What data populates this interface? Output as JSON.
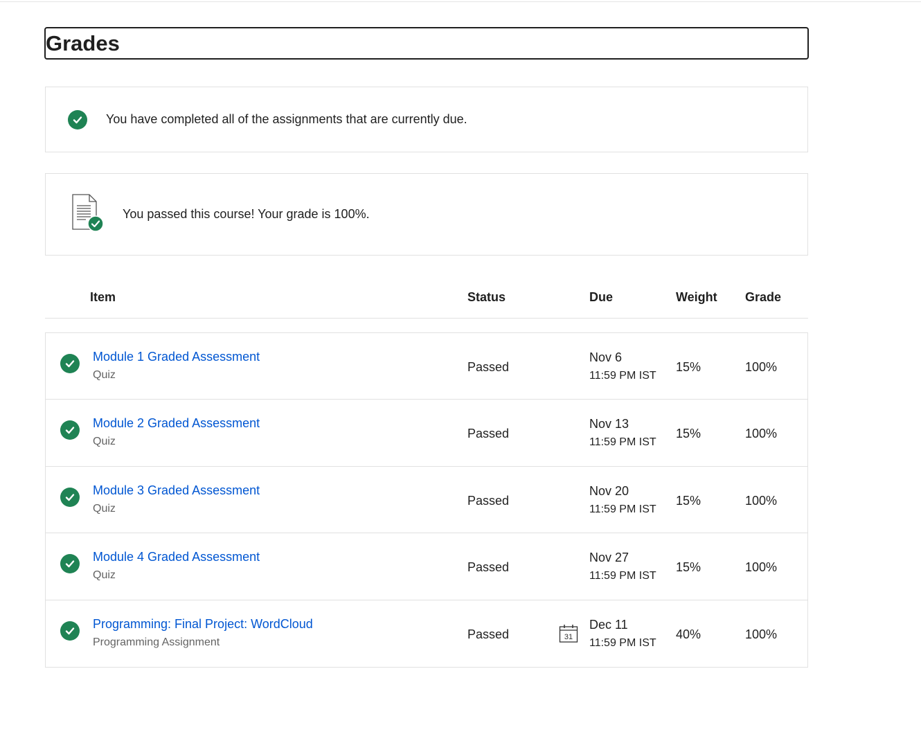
{
  "page": {
    "title": "Grades"
  },
  "banners": {
    "due_message": "You have completed all of the assignments that are currently due.",
    "pass_message": "You passed this course! Your grade is 100%."
  },
  "table": {
    "headers": {
      "item": "Item",
      "status": "Status",
      "due": "Due",
      "weight": "Weight",
      "grade": "Grade"
    },
    "rows": [
      {
        "title": "Module 1 Graded Assessment",
        "type": "Quiz",
        "status": "Passed",
        "due_date": "Nov 6",
        "due_time": "11:59 PM IST",
        "weight": "15%",
        "grade": "100%",
        "calendar": ""
      },
      {
        "title": "Module 2 Graded Assessment",
        "type": "Quiz",
        "status": "Passed",
        "due_date": "Nov 13",
        "due_time": "11:59 PM IST",
        "weight": "15%",
        "grade": "100%",
        "calendar": ""
      },
      {
        "title": "Module 3 Graded Assessment",
        "type": "Quiz",
        "status": "Passed",
        "due_date": "Nov 20",
        "due_time": "11:59 PM IST",
        "weight": "15%",
        "grade": "100%",
        "calendar": ""
      },
      {
        "title": "Module 4 Graded Assessment",
        "type": "Quiz",
        "status": "Passed",
        "due_date": "Nov 27",
        "due_time": "11:59 PM IST",
        "weight": "15%",
        "grade": "100%",
        "calendar": ""
      },
      {
        "title": "Programming: Final Project: WordCloud",
        "type": "Programming Assignment",
        "status": "Passed",
        "due_date": "Dec 11",
        "due_time": "11:59 PM IST",
        "weight": "40%",
        "grade": "100%",
        "calendar": "31"
      }
    ]
  },
  "icons": {
    "completed": "check-circle-icon",
    "course_passed": "document-check-icon",
    "calendar": "calendar-icon"
  },
  "colors": {
    "success_green": "#1f8354",
    "link_blue": "#0056d2",
    "text": "#1f1f1f",
    "muted_text": "#636363",
    "border": "#e1e1e1"
  }
}
